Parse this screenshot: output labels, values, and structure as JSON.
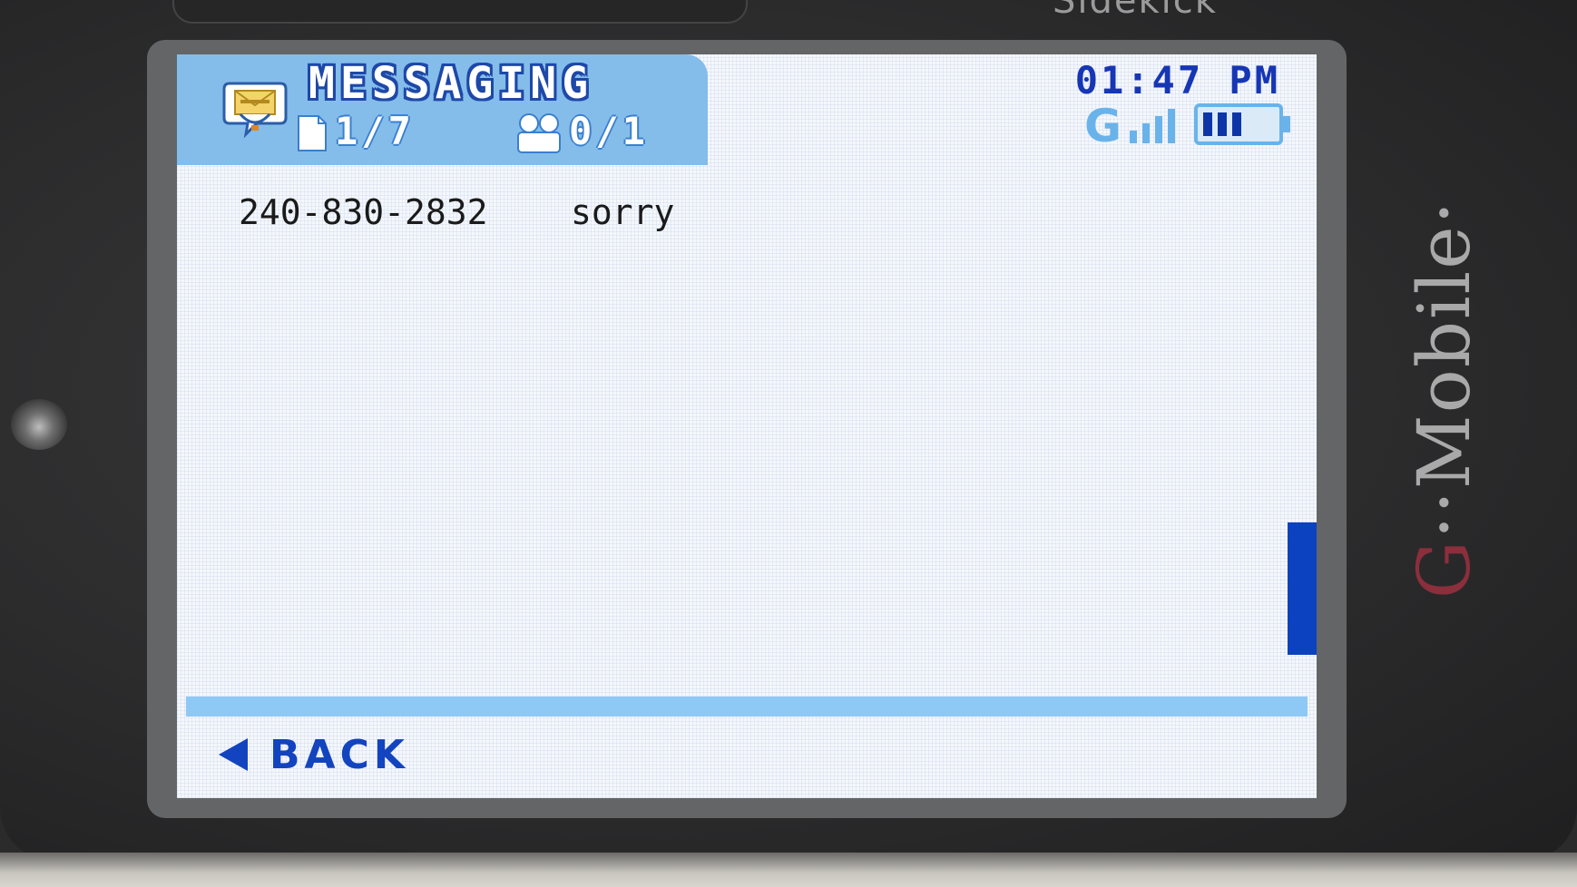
{
  "device": {
    "brand_top": "Sidekick",
    "side_brand_prefix": "G",
    "side_brand_rest": "··Mobile·"
  },
  "header": {
    "app_title": "MESSAGING",
    "message_counter": "1/7",
    "mms_counter": "0/1"
  },
  "status": {
    "time": "01:47 PM",
    "network": "G",
    "battery_level": 0.75
  },
  "message": {
    "from": "240-830-2832",
    "body": "sorry"
  },
  "footer": {
    "back_label": "BACK"
  },
  "colors": {
    "header_tab": "#84bdea",
    "accent_blue": "#1344bf",
    "scroll_thumb": "#0c42c0",
    "divider": "#8ec8f4"
  }
}
